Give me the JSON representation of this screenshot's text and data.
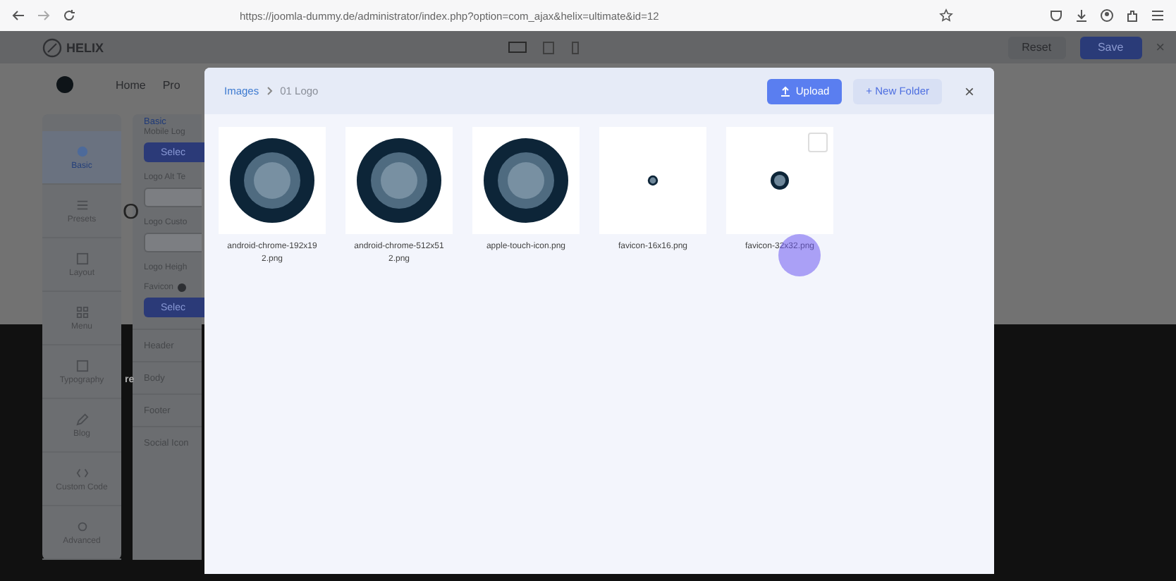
{
  "browser": {
    "url": "https://joomla-dummy.de/administrator/index.php?option=com_ajax&helix=ultimate&id=12"
  },
  "header": {
    "logo": "HELIX",
    "buttons": [
      {
        "label": "Reset",
        "kind": "reset"
      },
      {
        "label": "Save",
        "kind": "save"
      }
    ],
    "close": "×"
  },
  "nav": [
    "Home",
    "Pro"
  ],
  "sidebar": {
    "items": [
      {
        "label": "Basic",
        "kind": "basic",
        "selected": true
      },
      {
        "label": "Presets",
        "kind": "presets",
        "selected": false
      },
      {
        "label": "Layout",
        "kind": "layout",
        "selected": false
      },
      {
        "label": "Menu",
        "kind": "menu",
        "selected": false
      },
      {
        "label": "Typography",
        "kind": "typography",
        "selected": false
      },
      {
        "label": "Blog",
        "kind": "blog",
        "selected": false
      },
      {
        "label": "Custom Code",
        "kind": "code",
        "selected": false
      },
      {
        "label": "Advanced",
        "kind": "advanced",
        "selected": false
      }
    ]
  },
  "panel": {
    "title": "Basic",
    "fields": [
      {
        "kind": "button",
        "label": "Mobile Log",
        "button": "Selec"
      },
      {
        "kind": "input",
        "label": "Logo Alt Te"
      },
      {
        "kind": "input",
        "label": "Logo Custo"
      },
      {
        "kind": "label",
        "label": "Logo Heigh"
      },
      {
        "kind": "button",
        "label": "Favicon",
        "button": "Selec",
        "info": true
      }
    ],
    "sections": [
      "Header",
      "Body",
      "Footer",
      "Social Icon"
    ]
  },
  "page_fragments": [
    "O",
    "re"
  ],
  "modal": {
    "breadcrumb": [
      "Images",
      "01 Logo"
    ],
    "upload": "Upload",
    "new_folder": "+ New Folder",
    "close": "×",
    "files": [
      {
        "name": "android-chrome-192x192.png",
        "kind": "large",
        "hover": false
      },
      {
        "name": "android-chrome-512x512.png",
        "kind": "large",
        "hover": false
      },
      {
        "name": "apple-touch-icon.png",
        "kind": "large",
        "hover": false
      },
      {
        "name": "favicon-16x16.png",
        "kind": "tiny",
        "hover": false
      },
      {
        "name": "favicon-32x32.png",
        "kind": "small",
        "hover": true,
        "checked": false
      }
    ]
  }
}
